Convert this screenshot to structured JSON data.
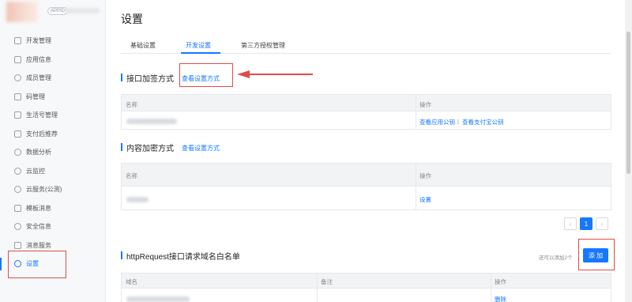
{
  "sidebar": {
    "app_badge": "APPID",
    "items": [
      {
        "label": "开发管理",
        "icon": "code-icon"
      },
      {
        "label": "应用信息",
        "icon": "grid-icon"
      },
      {
        "label": "成员管理",
        "icon": "user-icon"
      },
      {
        "label": "码管理",
        "icon": "qrcode-icon"
      },
      {
        "label": "生活号管理",
        "icon": "document-icon"
      },
      {
        "label": "支付后推荐",
        "icon": "card-icon"
      },
      {
        "label": "数据分析",
        "icon": "chart-icon"
      },
      {
        "label": "云监控",
        "icon": "cloud-icon"
      },
      {
        "label": "云服务(公测)",
        "icon": "cloud-service-icon"
      },
      {
        "label": "模板消息",
        "icon": "message-icon"
      },
      {
        "label": "安全信息",
        "icon": "shield-icon"
      },
      {
        "label": "消息服务",
        "icon": "mail-icon"
      },
      {
        "label": "设置",
        "icon": "gear-icon"
      }
    ]
  },
  "main": {
    "title": "设置",
    "tabs": [
      {
        "label": "基础设置"
      },
      {
        "label": "开发设置"
      },
      {
        "label": "第三方授权管理"
      }
    ],
    "signing": {
      "title": "接口加签方式",
      "link": "查看设置方式",
      "col_name": "名称",
      "col_action": "操作",
      "action1": "查看应用公钥",
      "sep": "|",
      "action2": "查看支付宝公钥"
    },
    "encryption": {
      "title": "内容加密方式",
      "link": "查看设置方式",
      "col_name": "名称",
      "col_action": "操作",
      "action": "设置"
    },
    "pager": {
      "prev": "‹",
      "page": "1",
      "next": "›"
    },
    "whitelist": {
      "title": "httpRequest接口请求域名白名单",
      "hint": "还可以添加2个",
      "add": "添 加",
      "col_domain": "域名",
      "col_note": "备注",
      "col_action": "操作",
      "action": "删除"
    }
  },
  "colors": {
    "accent": "#1677ff",
    "annotation": "#e04b4b"
  }
}
